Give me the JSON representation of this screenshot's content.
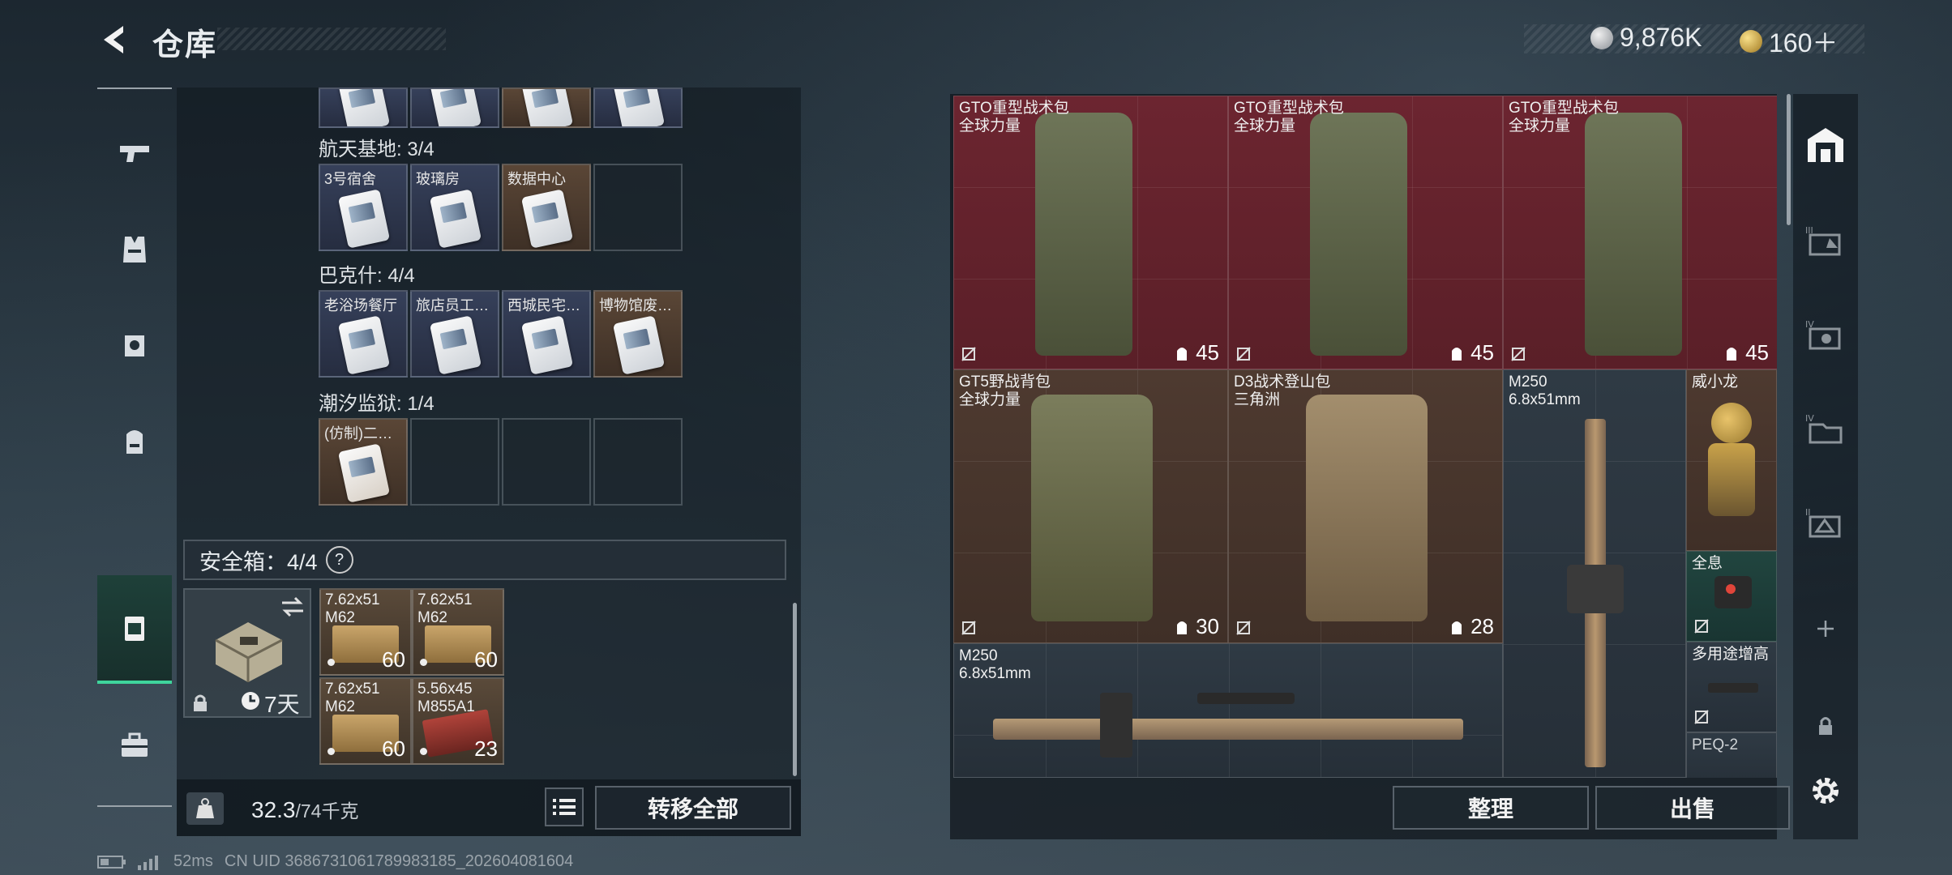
{
  "header": {
    "title": "仓库",
    "currency_1": "9,876K",
    "currency_2": "160＋"
  },
  "left_panel": {
    "top_row_partial": [
      "",
      "",
      "",
      ""
    ],
    "sections": [
      {
        "label": "航天基地: 3/4",
        "items": [
          "3号宿舍",
          "玻璃房",
          "数据中心",
          ""
        ]
      },
      {
        "label": "巴克什: 4/4",
        "items": [
          "老浴场餐厅",
          "旅店员工…",
          "西城民宅…",
          "博物馆废…"
        ]
      },
      {
        "label": "潮汐监狱: 1/4",
        "items": [
          "(仿制)二…",
          "",
          "",
          ""
        ]
      }
    ],
    "safe_box": {
      "label": "安全箱：4/4",
      "help": "?",
      "timer": "7天",
      "ammo": [
        {
          "name": "7.62x51\nM62",
          "qty": "60"
        },
        {
          "name": "7.62x51\nM62",
          "qty": "60"
        },
        {
          "name": "7.62x51\nM62",
          "qty": "60"
        },
        {
          "name": "5.56x45\nM855A1",
          "qty": "23"
        }
      ]
    },
    "weight": {
      "current": "32.3",
      "max": "/74千克"
    },
    "transfer_all": "转移全部"
  },
  "inventory": {
    "items": [
      {
        "name": "GTO重型战术包",
        "sub": "全球力量",
        "cap": "45"
      },
      {
        "name": "GTO重型战术包",
        "sub": "全球力量",
        "cap": "45"
      },
      {
        "name": "GTO重型战术包",
        "sub": "全球力量",
        "cap": "45"
      },
      {
        "name": "GT5野战背包",
        "sub": "全球力量",
        "cap": "30"
      },
      {
        "name": "D3战术登山包",
        "sub": "三角洲",
        "cap": "28"
      },
      {
        "name": "M250",
        "sub": "6.8x51mm"
      },
      {
        "name": "威小龙",
        "sub": ""
      },
      {
        "name": "全息",
        "sub": ""
      },
      {
        "name": "M250",
        "sub": "6.8x51mm"
      },
      {
        "name": "多用途增高",
        "sub": ""
      },
      {
        "name": "PEQ-2",
        "sub": ""
      }
    ],
    "organize": "整理",
    "sell": "出售"
  },
  "status_bar": {
    "ping": "52ms",
    "uid": "CN UID 3686731061789983185_202604081604"
  }
}
